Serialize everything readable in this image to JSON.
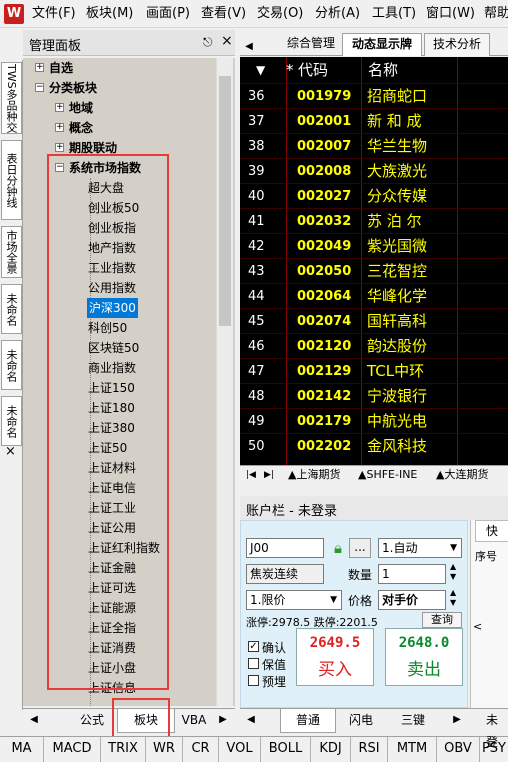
{
  "menubar": {
    "items": [
      "文件(F)",
      "板块(M)",
      "画面(P)",
      "查看(V)",
      "交易(O)",
      "分析(A)",
      "工具(T)",
      "窗口(W)",
      "帮助"
    ]
  },
  "vtabs": [
    "TWS多品种交",
    "表日分钟线",
    "市场全景",
    "未命名",
    "未命名",
    "未命名"
  ],
  "vtab_close": "×",
  "panel": {
    "title": "管理面板",
    "pin": "ᵖ",
    "close": "×",
    "tree_top": [
      {
        "label": "自选",
        "exp": "+"
      },
      {
        "label": "分类板块",
        "exp": "−"
      },
      {
        "label": "地域",
        "exp": "+"
      },
      {
        "label": "概念",
        "exp": "+"
      },
      {
        "label": "期股联动",
        "exp": "+"
      },
      {
        "label": "系统市场指数",
        "exp": "−"
      }
    ],
    "leaves": [
      "超大盘",
      "创业板50",
      "创业板指",
      "地产指数",
      "工业指数",
      "公用指数",
      "沪深300",
      "科创50",
      "区块链50",
      "商业指数",
      "上证150",
      "上证180",
      "上证380",
      "上证50",
      "上证材料",
      "上证电信",
      "上证工业",
      "上证公用",
      "上证红利指数",
      "上证金融",
      "上证可选",
      "上证能源",
      "上证全指",
      "上证消费",
      "上证小盘",
      "上证信息"
    ],
    "selected_index": 6,
    "bottom_tabs": [
      "公式",
      "板块",
      "VBA"
    ]
  },
  "indicators": [
    "MA",
    "MACD",
    "TRIX",
    "WR",
    "CR",
    "VOL",
    "BOLL",
    "KDJ",
    "RSI",
    "MTM",
    "OBV",
    "PSY"
  ],
  "right_tabs": [
    "综合管理",
    "动态显示牌",
    "技术分析"
  ],
  "quote": {
    "headers": {
      "sort": "▼",
      "star": "*",
      "code": "代码",
      "name": "名称"
    },
    "rows": [
      {
        "n": "36",
        "code": "001979",
        "name": "招商蛇口"
      },
      {
        "n": "37",
        "code": "002001",
        "name": "新 和 成"
      },
      {
        "n": "38",
        "code": "002007",
        "name": "华兰生物"
      },
      {
        "n": "39",
        "code": "002008",
        "name": "大族激光"
      },
      {
        "n": "40",
        "code": "002027",
        "name": "分众传媒"
      },
      {
        "n": "41",
        "code": "002032",
        "name": "苏 泊 尔"
      },
      {
        "n": "42",
        "code": "002049",
        "name": "紫光国微"
      },
      {
        "n": "43",
        "code": "002050",
        "name": "三花智控"
      },
      {
        "n": "44",
        "code": "002064",
        "name": "华峰化学"
      },
      {
        "n": "45",
        "code": "002074",
        "name": "国轩高科"
      },
      {
        "n": "46",
        "code": "002120",
        "name": "韵达股份"
      },
      {
        "n": "47",
        "code": "002129",
        "name": "TCL中环"
      },
      {
        "n": "48",
        "code": "002142",
        "name": "宁波银行"
      },
      {
        "n": "49",
        "code": "002179",
        "name": "中航光电"
      },
      {
        "n": "50",
        "code": "002202",
        "name": "金风科技"
      }
    ],
    "market_tabs": [
      "▲上海期货",
      "▲SHFE-INE",
      "▲大连期货"
    ]
  },
  "account": {
    "title": "账户栏 - 未登录",
    "contract": "J00",
    "mode": "1.自动",
    "contract_name": "焦炭连续",
    "qty_label": "数量",
    "qty": "1",
    "price_type": "1.限价",
    "price_label": "价格",
    "price": "对手价",
    "limits": "涨停:2978.5 跌停:2201.5",
    "query_btn": "查询",
    "checks": [
      "确认",
      "保值",
      "预埋"
    ],
    "buy_price": "2649.5",
    "buy_label": "买入",
    "sell_price": "2648.0",
    "sell_label": "卖出",
    "bottom_tabs": [
      "普通",
      "闪电",
      "三键"
    ],
    "side_tab": "快",
    "side_header": "序号",
    "side_bottom": "未登"
  },
  "colors": {
    "buy": "#e02020",
    "sell": "#0a8a2a",
    "quote_code": "#ffff00",
    "highlight": "#e83a3a",
    "selected_bg": "#0078d7"
  }
}
